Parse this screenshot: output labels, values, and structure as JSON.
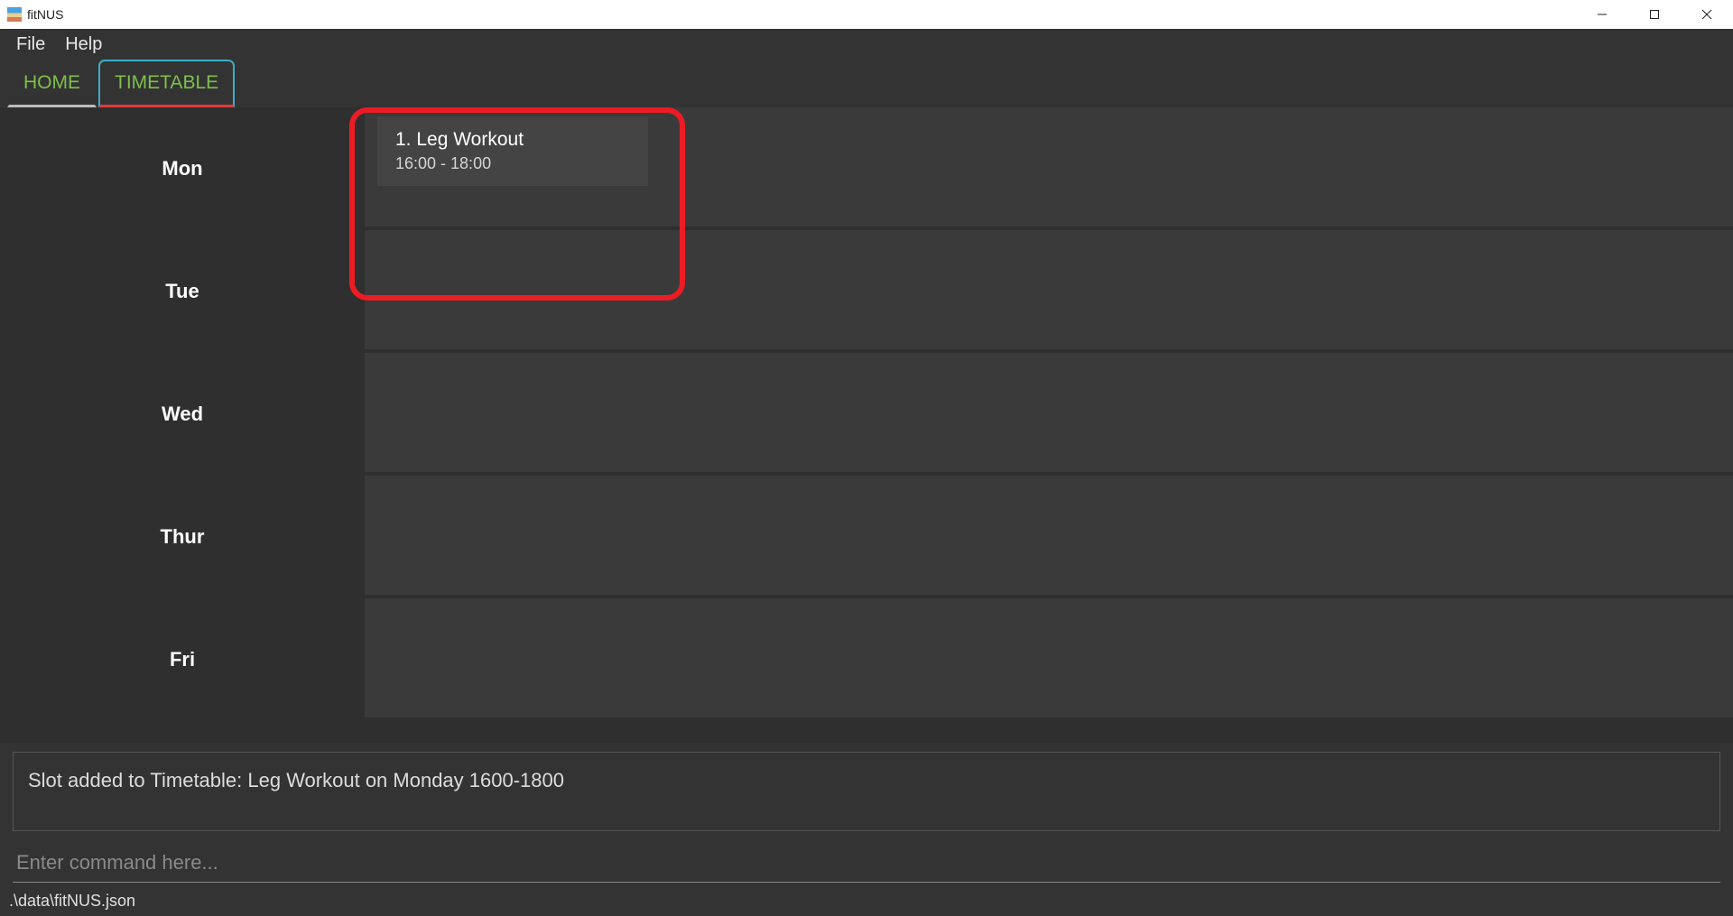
{
  "window": {
    "title": "fitNUS"
  },
  "menubar": {
    "file": "File",
    "help": "Help"
  },
  "tabs": {
    "home": "HOME",
    "timetable": "TIMETABLE"
  },
  "timetable": {
    "days": [
      "Mon",
      "Tue",
      "Wed",
      "Thur",
      "Fri"
    ],
    "slots": {
      "mon": [
        {
          "title": "1.   Leg Workout",
          "time": "16:00 - 18:00"
        }
      ]
    }
  },
  "status": {
    "message": "Slot added to Timetable: Leg Workout on Monday 1600-1800"
  },
  "command": {
    "placeholder": "Enter command here..."
  },
  "footer": {
    "path": ".\\data\\fitNUS.json"
  },
  "annotation": {
    "visible": true
  }
}
